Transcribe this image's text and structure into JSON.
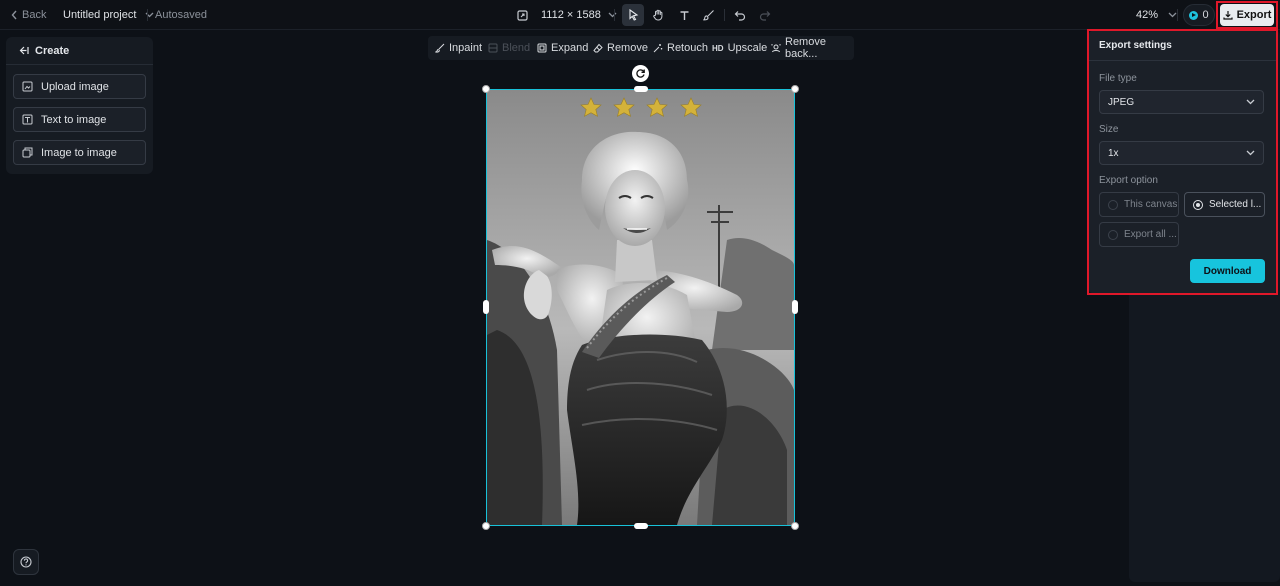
{
  "topbar": {
    "back_label": "Back",
    "project_title": "Untitled project",
    "save_status": "Autosaved",
    "canvas_size": "1112 × 1588",
    "zoom": "42%",
    "credits": "0",
    "export_label": "Export"
  },
  "create_panel": {
    "title": "Create",
    "items": [
      {
        "label": "Upload image"
      },
      {
        "label": "Text to image"
      },
      {
        "label": "Image to image"
      }
    ]
  },
  "edit_toolbar": {
    "items": [
      {
        "label": "Inpaint"
      },
      {
        "label": "Blend"
      },
      {
        "label": "Expand"
      },
      {
        "label": "Remove"
      },
      {
        "label": "Retouch"
      },
      {
        "label": "Upscale"
      },
      {
        "label": "Remove back..."
      }
    ],
    "upscale_badge": "HD"
  },
  "export_settings": {
    "title": "Export settings",
    "file_type_label": "File type",
    "file_type_value": "JPEG",
    "size_label": "Size",
    "size_value": "1x",
    "export_option_label": "Export option",
    "options": [
      {
        "label": "This canvas",
        "selected": false
      },
      {
        "label": "Selected l...",
        "selected": true
      },
      {
        "label": "Export all ...",
        "selected": false
      }
    ],
    "download_label": "Download"
  },
  "colors": {
    "accent": "#17c4dd",
    "highlight": "#e0182a",
    "background": "#0d1117"
  }
}
